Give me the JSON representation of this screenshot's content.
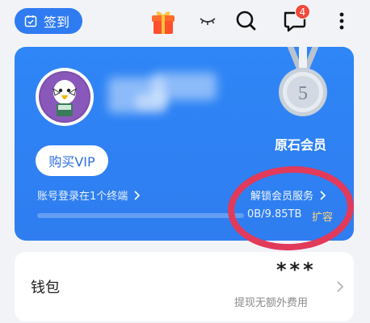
{
  "header": {
    "checkin_label": "签到",
    "notification_count": "4"
  },
  "account": {
    "vip_button_label": "购买VIP",
    "login_status": "账号登录在1个终端",
    "membership_tier": "原石会员",
    "medal_number": "5",
    "unlock_services_label": "解锁会员服务",
    "storage_used_text": "0B/9.85TB",
    "storage_used_fraction": 0.0,
    "expand_label": "扩容"
  },
  "wallet": {
    "title": "钱包",
    "value_masked": "***",
    "subtitle": "提现无额外费用"
  },
  "colors": {
    "primary_blue": "#2f7bf2",
    "badge_red": "#f24a3d",
    "expand_gold": "#ffd47a",
    "annotation_red": "#e13a5a"
  }
}
